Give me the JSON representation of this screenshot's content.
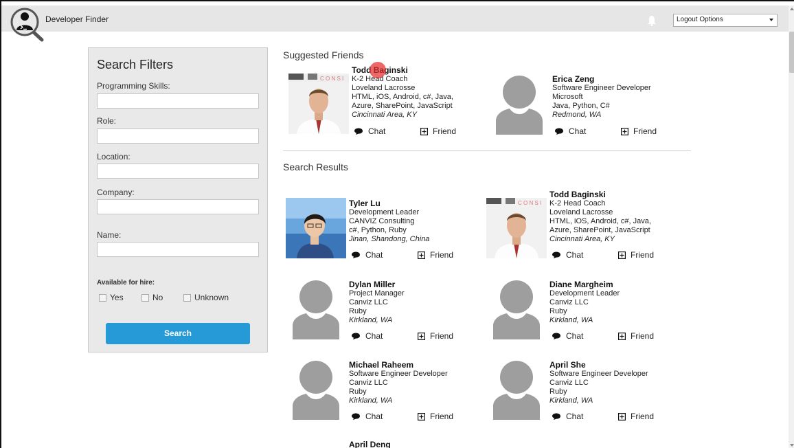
{
  "header": {
    "title": "Developer Finder",
    "logout_label": "Logout Options"
  },
  "filters": {
    "title": "Search Filters",
    "fields": [
      {
        "label": "Programming Skills:"
      },
      {
        "label": "Role:"
      },
      {
        "label": "Location:"
      },
      {
        "label": "Company:"
      },
      {
        "label": "Name:"
      }
    ],
    "hire_label": "Available for hire:",
    "hire_options": [
      "Yes",
      "No",
      "Unknown"
    ],
    "search_label": "Search"
  },
  "actions": {
    "chat": "Chat",
    "friend": "Friend"
  },
  "suggested": {
    "title": "Suggested Friends",
    "people": [
      {
        "name": "Todd Baginski",
        "lines": [
          "K-2 Head Coach",
          "Loveland Lacrosse",
          "HTML, iOS, Android, c#, Java,",
          "Azure, SharePoint, JavaScript"
        ],
        "location": "Cincinnati Area, KY"
      },
      {
        "name": "Erica Zeng",
        "lines": [
          "Software Engineer Developer",
          "Microsoft",
          "Java, Python, C#"
        ],
        "location": "Redmond, WA"
      }
    ]
  },
  "results": {
    "title": "Search Results",
    "people": [
      {
        "name": "Tyler Lu",
        "lines": [
          "Development Leader",
          "CANVIZ Consulting",
          "c#, Python, Ruby"
        ],
        "location": "Jinan, Shandong, China"
      },
      {
        "name": "Todd Baginski",
        "lines": [
          "K-2 Head Coach",
          "Loveland Lacrosse",
          "HTML, iOS, Android, c#, Java,",
          "Azure, SharePoint, JavaScript"
        ],
        "location": "Cincinnati Area, KY"
      },
      {
        "name": "Dylan Miller",
        "lines": [
          "Project Manager",
          "Canviz LLC",
          "Ruby"
        ],
        "location": "Kirkland, WA"
      },
      {
        "name": "Diane Margheim",
        "lines": [
          "Development Leader",
          "Canviz LLC",
          "Ruby"
        ],
        "location": "Kirkland, WA"
      },
      {
        "name": "Michael Raheem",
        "lines": [
          "Software Engineer Developer",
          "Canviz LLC",
          "Ruby"
        ],
        "location": "Kirkland, WA"
      },
      {
        "name": "April She",
        "lines": [
          "Software Engineer Developer",
          "Canviz LLC",
          "Ruby"
        ],
        "location": "Kirkland, WA"
      },
      {
        "name": "April Deng",
        "lines": [],
        "location": ""
      }
    ]
  }
}
